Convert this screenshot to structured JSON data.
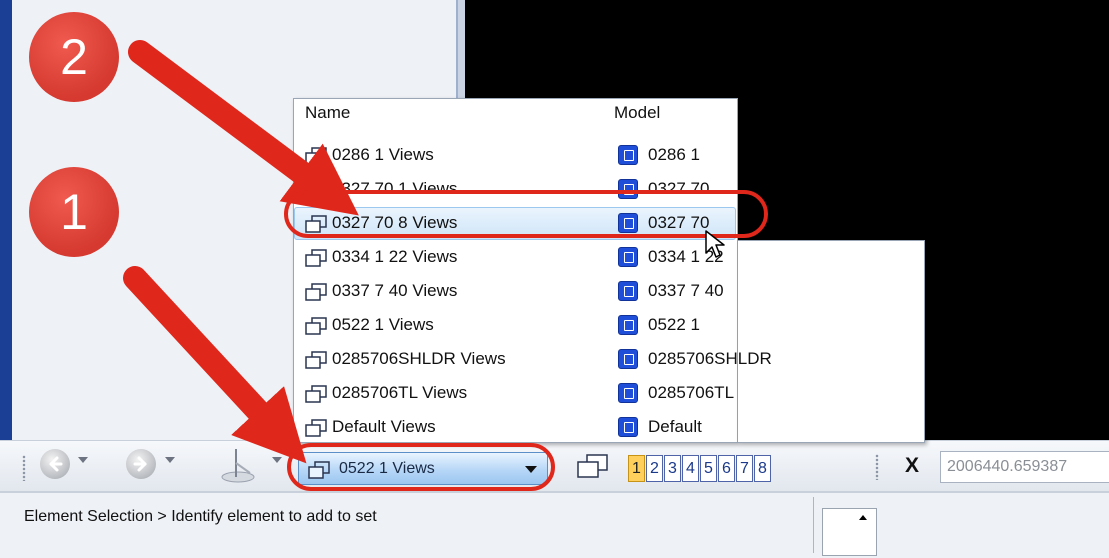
{
  "dropdown": {
    "columns": {
      "name": "Name",
      "model": "Model"
    },
    "rows": [
      {
        "name": "0286  1 Views",
        "model": "0286  1"
      },
      {
        "name": "0327 70  1 Views",
        "model": "0327 70"
      },
      {
        "name": "0327 70  8 Views",
        "model": "0327 70"
      },
      {
        "name": "0334  1 22 Views",
        "model": "0334  1 22"
      },
      {
        "name": "0337  7 40 Views",
        "model": "0337  7 40"
      },
      {
        "name": "0522  1 Views",
        "model": "0522  1"
      },
      {
        "name": "0285706SHLDR Views",
        "model": "0285706SHLDR"
      },
      {
        "name": "0285706TL Views",
        "model": "0285706TL"
      },
      {
        "name": "Default Views",
        "model": "Default"
      }
    ],
    "selected_index": 2
  },
  "toolbar": {
    "view_select_value": "0522  1 Views",
    "view_numbers": [
      "1",
      "2",
      "3",
      "4",
      "5",
      "6",
      "7",
      "8"
    ],
    "active_view": "1",
    "x_label": "X",
    "x_coordinate": "2006440.659387"
  },
  "statusbar": {
    "message": "Element Selection > Identify element to add to set"
  },
  "annotations": {
    "callout_1": "1",
    "callout_2": "2",
    "color": "#e0271b"
  },
  "icons": {
    "back": "back-arrow-icon",
    "forward": "forward-arrow-icon",
    "view_group": "view-group-icon",
    "model": "model-icon"
  }
}
